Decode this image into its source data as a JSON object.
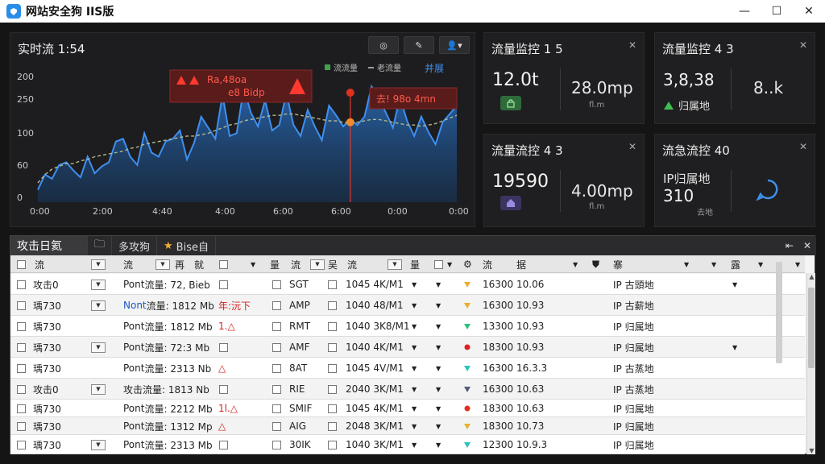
{
  "window": {
    "title": "网站安全狗 IIS版",
    "controls": [
      "—",
      "☐",
      "✕"
    ]
  },
  "chart_panel": {
    "title": "实时流 1:54",
    "legend": [
      {
        "label": "流流量",
        "color": "#3fa34d"
      },
      {
        "label": "老流量",
        "color": "#9a9a9a"
      }
    ],
    "legend_action": "并展",
    "alert_left": "Ra,48oa",
    "alert_left_sub": "e8 Bidp",
    "alert_right": "去! 98o 4mn",
    "toolbar_icons": [
      "refresh-icon",
      "edit-icon",
      "user-menu-icon"
    ]
  },
  "chart_data": {
    "type": "line",
    "x": [
      "0:00",
      "2:00",
      "4:40",
      "4:00",
      "6:00",
      "6:00",
      "0:00",
      "0:00"
    ],
    "yticks": [
      0,
      60,
      100,
      250,
      200
    ],
    "series": [
      {
        "values": [
          18,
          40,
          34,
          54,
          58,
          46,
          36,
          66,
          42,
          52,
          58,
          88,
          92,
          66,
          54,
          100,
          72,
          66,
          88,
          92,
          104,
          62,
          86,
          124,
          108,
          92,
          156,
          96,
          100,
          166,
          130,
          110,
          148,
          104,
          112,
          158,
          112,
          96,
          134,
          110,
          90,
          140,
          126,
          110,
          120,
          112,
          124,
          168,
          152,
          130,
          108,
          152,
          118,
          96,
          124,
          102,
          84,
          116,
          128,
          140
        ]
      },
      {
        "values": [
          28,
          40,
          48,
          52,
          56,
          56,
          60,
          62,
          66,
          68,
          70,
          72,
          74,
          78,
          80,
          84,
          86,
          88,
          90,
          92,
          94,
          96,
          96,
          98,
          100,
          104,
          108,
          112,
          114,
          118,
          120,
          122,
          124,
          126,
          126,
          128,
          128,
          126,
          124,
          122,
          120,
          118,
          118,
          116,
          116,
          116,
          118,
          120,
          120,
          118,
          116,
          114,
          112,
          112,
          110,
          112,
          114,
          118,
          122,
          126
        ]
      }
    ],
    "marker_index": 44,
    "grid": false
  },
  "cards": [
    {
      "title": "流量监控 1 5",
      "big": "12.0t",
      "sub": "28.0mp",
      "unit": "fl.m"
    },
    {
      "title": "流量监控 4 3",
      "big": "3,8,38",
      "sub": "8..k",
      "note": "归属地"
    },
    {
      "title": "流量流控 4 3",
      "big": "19590",
      "sub": "4.00mp",
      "unit": "fl.m"
    },
    {
      "title": "流急流控 40",
      "big": "IP归属地",
      "big2": "310",
      "unit": "去地"
    }
  ],
  "log_panel": {
    "tabs": [
      "攻击日氦",
      "多攻狗",
      "Bise自"
    ],
    "columns": [
      "流",
      "流",
      "再",
      "就",
      "量",
      "流",
      "吴",
      "流",
      "量",
      "流",
      "据",
      "寨",
      "露"
    ],
    "rows": [
      {
        "a": "攻击0",
        "b_pre": "Pont",
        "b": "流量: 72, Bieb",
        "m": "SGT",
        "n": "1045 4K/M1",
        "q": "16300 10.06",
        "r": "IP 古頭地",
        "mark": "#e8b030",
        "warn": ""
      },
      {
        "a": "瑀730",
        "b_pre": "Nont",
        "b": "流量: 1812 Mb",
        "m": "AMP",
        "n": "1040 48/M1",
        "q": "16300 10.93",
        "r": "IP 古薪地",
        "mark": "#e8b030",
        "warn": "年:沅下"
      },
      {
        "a": "瑀730",
        "b_pre": "Pont",
        "b": "流量: 1812 Mb",
        "m": "RMT",
        "n": "1040 3K8/M1",
        "q": "13300 10.93",
        "r": "IP 归属地",
        "mark": "#2fbf80",
        "warn": "1.△"
      },
      {
        "a": "瑀730",
        "b_pre": "Pont",
        "b": "流量: 72:3 Mb",
        "m": "AMF",
        "n": "1040 4K/M1",
        "q": "18300 10.93",
        "r": "IP 归属地",
        "mark": "#e02020",
        "warn": ""
      },
      {
        "a": "瑀730",
        "b_pre": "Pont",
        "b": "流量: 2313 Nb",
        "m": "8AT",
        "n": "1045 4V/M1",
        "q": "16300 16.3.3",
        "r": "IP 古蒸地",
        "mark": "#27c4c0",
        "warn": "△"
      },
      {
        "a": "攻击0",
        "b_pre": "攻击",
        "b": "流量: 1813 Nb",
        "m": "RIE",
        "n": "2040 3K/M1",
        "q": "16300 10.63",
        "r": "IP 古蒸地",
        "mark": "#555a80",
        "warn": ""
      },
      {
        "a": "瑀730",
        "b_pre": "Pont",
        "b": "流量: 2212 Mb",
        "m": "SMIF",
        "n": "1045 4K/M1",
        "q": "18300 10.63",
        "r": "IP 归属地",
        "mark": "#e03020",
        "warn": "1l.△"
      },
      {
        "a": "瑀730",
        "b_pre": "Pont",
        "b": "流量: 1312 Mp",
        "m": "AIG",
        "n": "2048 3K/M1",
        "q": "18300 10.73",
        "r": "IP 归属地",
        "mark": "#e8b030",
        "warn": "△"
      },
      {
        "a": "瑀730",
        "b_pre": "Pont",
        "b": "流量: 2313 Mb",
        "m": "30IK",
        "n": "1040 3K/M1",
        "q": "12300 10.9.3",
        "r": "IP 归属地",
        "mark": "#27c4c0",
        "warn": ""
      }
    ]
  }
}
